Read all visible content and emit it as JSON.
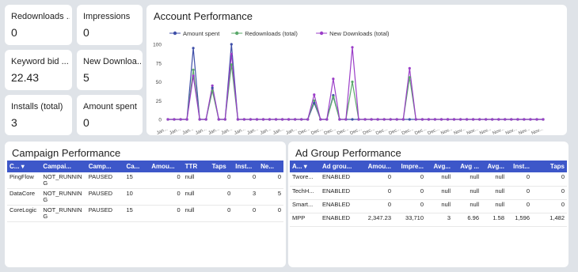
{
  "kpis": [
    {
      "label": "Redownloads ...",
      "value": "0"
    },
    {
      "label": "Impressions",
      "value": "0"
    },
    {
      "label": "Keyword bid ...",
      "value": "22.43"
    },
    {
      "label": "New Downloa...",
      "value": "5"
    },
    {
      "label": "Installs (total)",
      "value": "3"
    },
    {
      "label": "Amount spent",
      "value": "0"
    }
  ],
  "account": {
    "title": "Account Performance"
  },
  "chart_data": {
    "type": "line",
    "title": "Account Performance",
    "ylim": [
      0,
      100
    ],
    "yticks": [
      0,
      25,
      50,
      75,
      100
    ],
    "grid": false,
    "legend": "top-left",
    "x_tick_labels": [
      "Jan...",
      "Jan...",
      "Jan...",
      "Jan...",
      "Jan...",
      "Jan...",
      "Jan...",
      "Jan...",
      "Jan...",
      "Jan...",
      "Jan...",
      "Dec...",
      "Dec...",
      "Dec...",
      "Dec...",
      "Dec...",
      "Dec...",
      "Dec...",
      "Dec...",
      "Dec...",
      "Dec...",
      "Dec...",
      "Nov...",
      "Nov...",
      "Nov...",
      "Nov...",
      "Nov...",
      "Nov...",
      "Nov...",
      "Nov..."
    ],
    "series": [
      {
        "name": "Amount spent",
        "color": "#3f4fa8",
        "values": [
          0,
          0,
          0,
          0,
          95,
          0,
          0,
          42,
          0,
          0,
          100,
          0,
          0,
          0,
          0,
          0,
          0,
          0,
          0,
          0,
          0,
          0,
          0,
          22,
          0,
          0,
          32,
          0,
          0,
          0,
          0,
          0,
          0,
          0,
          0,
          0,
          0,
          0,
          0,
          0,
          0,
          0,
          0,
          0,
          0,
          0,
          0,
          0,
          0,
          0,
          0,
          0,
          0,
          0,
          0,
          0,
          0,
          0,
          0,
          0
        ]
      },
      {
        "name": "Redownloads (total)",
        "color": "#5aa86a",
        "values": [
          0,
          0,
          0,
          0,
          66,
          0,
          0,
          38,
          0,
          0,
          73,
          0,
          0,
          0,
          0,
          0,
          0,
          0,
          0,
          0,
          0,
          0,
          0,
          25,
          0,
          0,
          30,
          0,
          0,
          50,
          0,
          0,
          0,
          0,
          0,
          0,
          0,
          0,
          56,
          0,
          0,
          0,
          0,
          0,
          0,
          0,
          0,
          0,
          0,
          0,
          0,
          0,
          0,
          0,
          0,
          0,
          0,
          0,
          0,
          0
        ]
      },
      {
        "name": "New Downloads (total)",
        "color": "#9b3ec8",
        "values": [
          0,
          0,
          0,
          0,
          58,
          0,
          0,
          45,
          0,
          0,
          87,
          0,
          0,
          0,
          0,
          0,
          0,
          0,
          0,
          0,
          0,
          0,
          0,
          33,
          0,
          0,
          54,
          0,
          0,
          96,
          0,
          0,
          0,
          0,
          0,
          0,
          0,
          0,
          68,
          0,
          0,
          0,
          0,
          0,
          0,
          0,
          0,
          0,
          0,
          0,
          0,
          0,
          0,
          0,
          0,
          0,
          0,
          0,
          0,
          0
        ]
      }
    ]
  },
  "campaign": {
    "title": "Campaign Performance",
    "columns": [
      "C...",
      "Campai...",
      "Camp...",
      "Ca...",
      "Amou...",
      "TTR",
      "Taps",
      "Inst...",
      "Ne..."
    ],
    "rows": [
      [
        "PingFlow",
        "NOT_RUNNING",
        "PAUSED",
        "15",
        "0",
        "null",
        "0",
        "0",
        "0"
      ],
      [
        "DataCore",
        "NOT_RUNNING",
        "PAUSED",
        "10",
        "0",
        "null",
        "0",
        "3",
        "5"
      ],
      [
        "CoreLogic",
        "NOT_RUNNING",
        "PAUSED",
        "15",
        "0",
        "null",
        "0",
        "0",
        "0"
      ]
    ]
  },
  "adgroup": {
    "title": "Ad Group Performance",
    "columns": [
      "A...",
      "Ad grou...",
      "Amou...",
      "Impre...",
      "Avg...",
      "Avg ...",
      "Avg...",
      "Inst...",
      "Taps"
    ],
    "rows": [
      [
        "Twore...",
        "ENABLED",
        "0",
        "0",
        "null",
        "null",
        "null",
        "0",
        "0"
      ],
      [
        "TechH...",
        "ENABLED",
        "0",
        "0",
        "null",
        "null",
        "null",
        "0",
        "0"
      ],
      [
        "Smart...",
        "ENABLED",
        "0",
        "0",
        "null",
        "null",
        "null",
        "0",
        "0"
      ],
      [
        "MPP",
        "ENABLED",
        "2,347.23",
        "33,710",
        "3",
        "6.96",
        "1.58",
        "1,596",
        "1,482"
      ]
    ]
  }
}
